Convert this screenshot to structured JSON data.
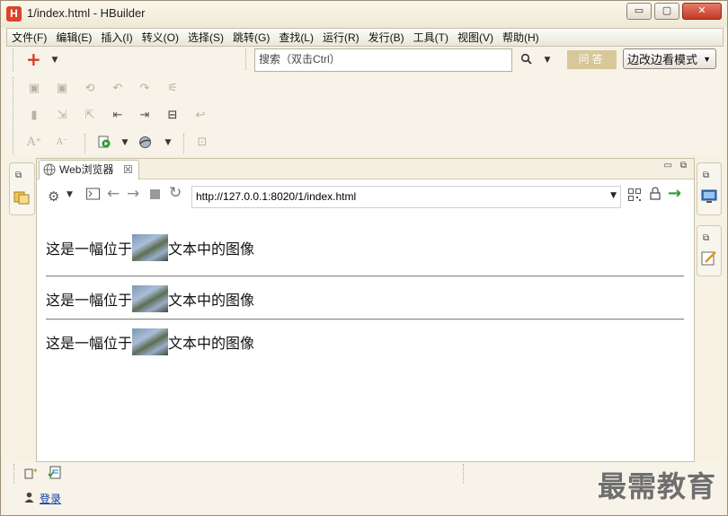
{
  "window": {
    "title": "1/index.html  -  HBuilder",
    "app_icon": "H",
    "buttons": {
      "minimize": "▭",
      "maximize": "▢",
      "close": "✕"
    }
  },
  "menu": [
    "文件(F)",
    "编辑(E)",
    "插入(I)",
    "转义(O)",
    "选择(S)",
    "跳转(G)",
    "查找(L)",
    "运行(R)",
    "发行(B)",
    "工具(T)",
    "视图(V)",
    "帮助(H)"
  ],
  "toolbar": {
    "search_placeholder": "搜索（双击Ctrl）",
    "ask_label": "问答",
    "mode_label": "边改边看模式"
  },
  "browser": {
    "tab_label": "Web浏览器",
    "url": "http://127.0.0.1:8020/1/index.html"
  },
  "content": {
    "line1_before": "这是一幅位于",
    "line1_after": "文本中的图像",
    "line2_before": "这是一幅位于",
    "line2_after": "文本中的图像",
    "line3_before": "这是一幅位于",
    "line3_after": "文本中的图像"
  },
  "footer": {
    "login_label": "登录",
    "watermark": "最需教育"
  },
  "colors": {
    "window_bg": "#f6f1e3",
    "accent_red": "#d9442b",
    "ask_button": "#d8c79a",
    "link_blue": "#0b3fa7",
    "go_arrow": "#2f9a2f"
  }
}
